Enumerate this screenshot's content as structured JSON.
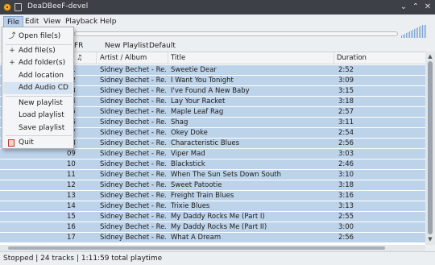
{
  "window": {
    "title": "DeaDBeeF-devel"
  },
  "menubar": [
    "File",
    "Edit",
    "View",
    "Playback",
    "Help"
  ],
  "file_menu": [
    "Open file(s)",
    "Add file(s)",
    "Add folder(s)",
    "Add location",
    "Add Audio CD",
    "New playlist",
    "Load playlist",
    "Save playlist",
    "Quit"
  ],
  "tabs": {
    "partial": "FR",
    "new_playlist": "New Playlist",
    "default": "Default"
  },
  "columns": {
    "num": "♫",
    "artist": "Artist / Album",
    "title": "Title",
    "duration": "Duration"
  },
  "tracks": [
    {
      "n": "01",
      "artist": "Sidney Bechet - Re...",
      "title": "Sweetie Dear",
      "dur": "2:52"
    },
    {
      "n": "02",
      "artist": "Sidney Bechet - Re...",
      "title": "I Want You Tonight",
      "dur": "3:09"
    },
    {
      "n": "03",
      "artist": "Sidney Bechet - Re...",
      "title": "I've Found A New Baby",
      "dur": "3:15"
    },
    {
      "n": "04",
      "artist": "Sidney Bechet - Re...",
      "title": "Lay Your Racket",
      "dur": "3:18"
    },
    {
      "n": "05",
      "artist": "Sidney Bechet - Re...",
      "title": "Maple Leaf Rag",
      "dur": "2:57"
    },
    {
      "n": "06",
      "artist": "Sidney Bechet - Re...",
      "title": "Shag",
      "dur": "3:11"
    },
    {
      "n": "07",
      "artist": "Sidney Bechet - Re...",
      "title": "Okey Doke",
      "dur": "2:54"
    },
    {
      "n": "08",
      "artist": "Sidney Bechet - Re...",
      "title": "Characteristic Blues",
      "dur": "2:56"
    },
    {
      "n": "09",
      "artist": "Sidney Bechet - Re...",
      "title": "Viper Mad",
      "dur": "3:03"
    },
    {
      "n": "10",
      "artist": "Sidney Bechet - Re...",
      "title": "Blackstick",
      "dur": "2:46"
    },
    {
      "n": "11",
      "artist": "Sidney Bechet - Re...",
      "title": "When The Sun Sets Down South",
      "dur": "3:10"
    },
    {
      "n": "12",
      "artist": "Sidney Bechet - Re...",
      "title": "Sweet Patootie",
      "dur": "3:18"
    },
    {
      "n": "13",
      "artist": "Sidney Bechet - Re...",
      "title": "Freight Train Blues",
      "dur": "3:16"
    },
    {
      "n": "14",
      "artist": "Sidney Bechet - Re...",
      "title": "Trixie Blues",
      "dur": "3:13"
    },
    {
      "n": "15",
      "artist": "Sidney Bechet - Re...",
      "title": "My Daddy Rocks Me (Part I)",
      "dur": "2:55"
    },
    {
      "n": "16",
      "artist": "Sidney Bechet - Re...",
      "title": "My Daddy Rocks Me (Part II)",
      "dur": "3:00"
    },
    {
      "n": "17",
      "artist": "Sidney Bechet - Re...",
      "title": "What A Dream",
      "dur": "2:56"
    }
  ],
  "status": "Stopped | 24 tracks | 1:11:59 total playtime",
  "colors": {
    "selection": "#bdd3ea",
    "titlebar": "#3d4046",
    "accent": "#7fa6d6"
  }
}
